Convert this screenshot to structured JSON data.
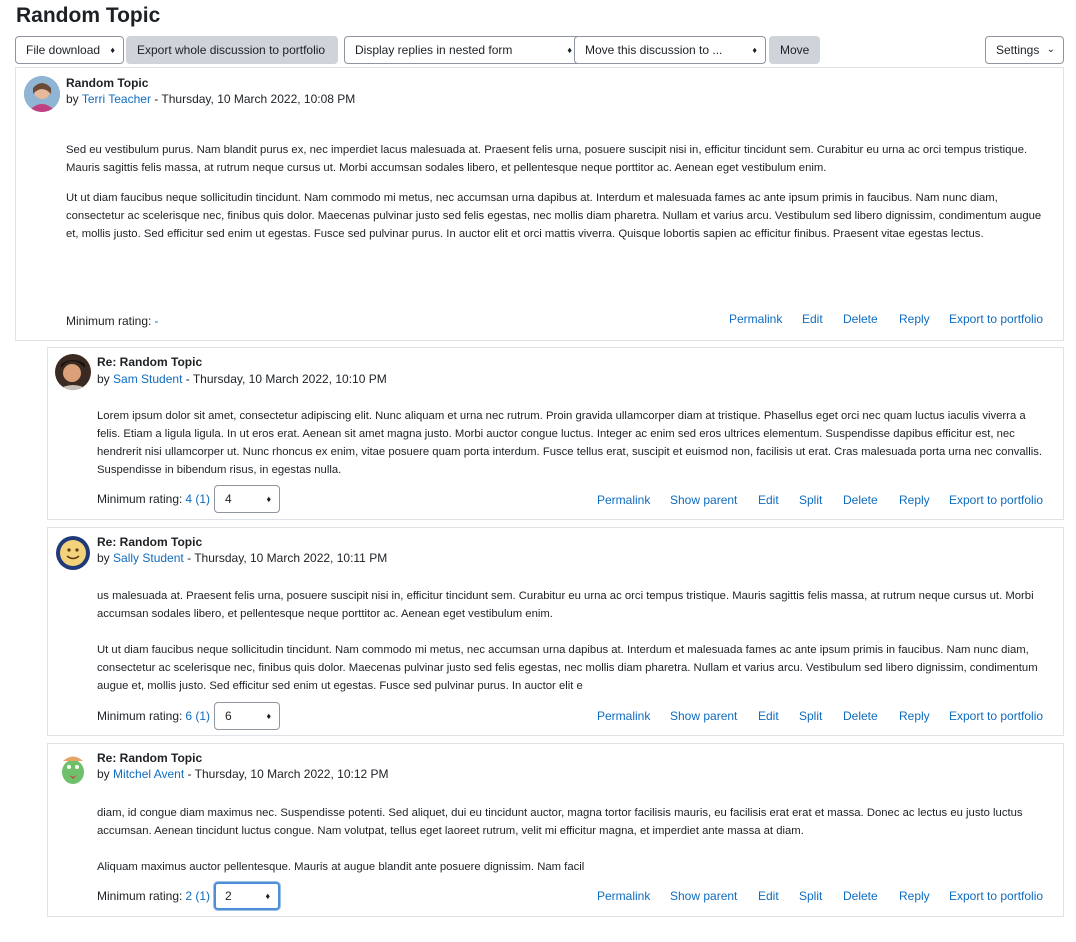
{
  "page": {
    "title": "Random Topic"
  },
  "toolbar": {
    "file_download": "File download",
    "export_discussion": "Export whole discussion to portfolio",
    "display_mode": "Display replies in nested form",
    "move_target": "Move this discussion to ...",
    "move": "Move",
    "settings": "Settings"
  },
  "posts": [
    {
      "subject": "Random Topic",
      "by": "by",
      "author": "Terri Teacher",
      "date": " - Thursday, 10 March 2022, 10:08 PM",
      "paragraphs": [
        "Sed eu vestibulum purus. Nam blandit purus ex, nec imperdiet lacus malesuada at. Praesent felis urna, posuere suscipit nisi in, efficitur tincidunt sem. Curabitur eu urna ac orci tempus tristique. Mauris sagittis felis massa, at rutrum neque cursus ut. Morbi accumsan sodales libero, et pellentesque neque porttitor ac. Aenean eget vestibulum enim.",
        "Ut ut diam faucibus neque sollicitudin tincidunt. Nam commodo mi metus, nec accumsan urna dapibus at. Interdum et malesuada fames ac ante ipsum primis in faucibus. Nam nunc diam, consectetur ac scelerisque nec, finibus quis dolor. Maecenas pulvinar justo sed felis egestas, nec mollis diam pharetra. Nullam et varius arcu. Vestibulum sed libero dignissim, condimentum augue et, mollis justo. Sed efficitur sed enim ut egestas. Fusce sed pulvinar purus. In auctor elit et orci mattis viverra. Quisque lobortis sapien ac efficitur finibus. Praesent vitae egestas lectus."
      ],
      "rating_label": "Minimum rating: ",
      "rating_value": "-",
      "links": [
        "Permalink",
        "Edit",
        "Delete",
        "Reply",
        "Export to portfolio"
      ]
    },
    {
      "subject": "Re: Random Topic",
      "by": "by",
      "author": "Sam Student",
      "date": " - Thursday, 10 March 2022, 10:10 PM",
      "paragraphs": [
        "Lorem ipsum dolor sit amet, consectetur adipiscing elit. Nunc aliquam et urna nec rutrum. Proin gravida ullamcorper diam at tristique. Phasellus eget orci nec quam luctus iaculis viverra a felis. Etiam a ligula ligula. In ut eros erat. Aenean sit amet magna justo. Morbi auctor congue luctus. Integer ac enim sed eros ultrices elementum. Suspendisse dapibus efficitur est, nec hendrerit nisi ullamcorper ut. Nunc rhoncus ex enim, vitae posuere quam porta interdum. Fusce tellus erat, suscipit et euismod non, facilisis ut erat. Cras malesuada porta urna nec convallis. Suspendisse in bibendum risus, in egestas nulla."
      ],
      "rating_label": "Minimum rating: ",
      "rating_value": "4 (1)",
      "rating_select": "4",
      "links": [
        "Permalink",
        "Show parent",
        "Edit",
        "Split",
        "Delete",
        "Reply",
        "Export to portfolio"
      ]
    },
    {
      "subject": "Re: Random Topic",
      "by": "by",
      "author": "Sally Student",
      "date": " - Thursday, 10 March 2022, 10:11 PM",
      "paragraphs": [
        "us malesuada at. Praesent felis urna, posuere suscipit nisi in, efficitur tincidunt sem. Curabitur eu urna ac orci tempus tristique. Mauris sagittis felis massa, at rutrum neque cursus ut. Morbi accumsan sodales libero, et pellentesque neque porttitor ac. Aenean eget vestibulum enim.",
        "Ut ut diam faucibus neque sollicitudin tincidunt. Nam commodo mi metus, nec accumsan urna dapibus at. Interdum et malesuada fames ac ante ipsum primis in faucibus. Nam nunc diam, consectetur ac scelerisque nec, finibus quis dolor. Maecenas pulvinar justo sed felis egestas, nec mollis diam pharetra. Nullam et varius arcu. Vestibulum sed libero dignissim, condimentum augue et, mollis justo. Sed efficitur sed enim ut egestas. Fusce sed pulvinar purus. In auctor elit e"
      ],
      "rating_label": "Minimum rating: ",
      "rating_value": "6 (1)",
      "rating_select": "6",
      "links": [
        "Permalink",
        "Show parent",
        "Edit",
        "Split",
        "Delete",
        "Reply",
        "Export to portfolio"
      ]
    },
    {
      "subject": "Re: Random Topic",
      "by": "by",
      "author": "Mitchel Avent",
      "date": " - Thursday, 10 March 2022, 10:12 PM",
      "paragraphs": [
        "diam, id congue diam maximus nec. Suspendisse potenti. Sed aliquet, dui eu tincidunt auctor, magna tortor facilisis mauris, eu facilisis erat erat et massa. Donec ac lectus eu justo luctus accumsan. Aenean tincidunt luctus congue. Nam volutpat, tellus eget laoreet rutrum, velit mi efficitur magna, et imperdiet ante massa at diam.",
        "Aliquam maximus auctor pellentesque. Mauris at augue blandit ante posuere dignissim. Nam facil"
      ],
      "rating_label": "Minimum rating: ",
      "rating_value": "2 (1)",
      "rating_select": "2",
      "links": [
        "Permalink",
        "Show parent",
        "Edit",
        "Split",
        "Delete",
        "Reply",
        "Export to portfolio"
      ]
    }
  ],
  "colors": {
    "link": "#0f6cbf",
    "border": "#dee2e6",
    "button_grey": "#ced4da",
    "focus": "#4e8ed6"
  },
  "icons": [
    "caret-updown-icon",
    "chevron-down-icon",
    "avatar-terri",
    "avatar-sam",
    "avatar-sally",
    "avatar-mitchel"
  ]
}
